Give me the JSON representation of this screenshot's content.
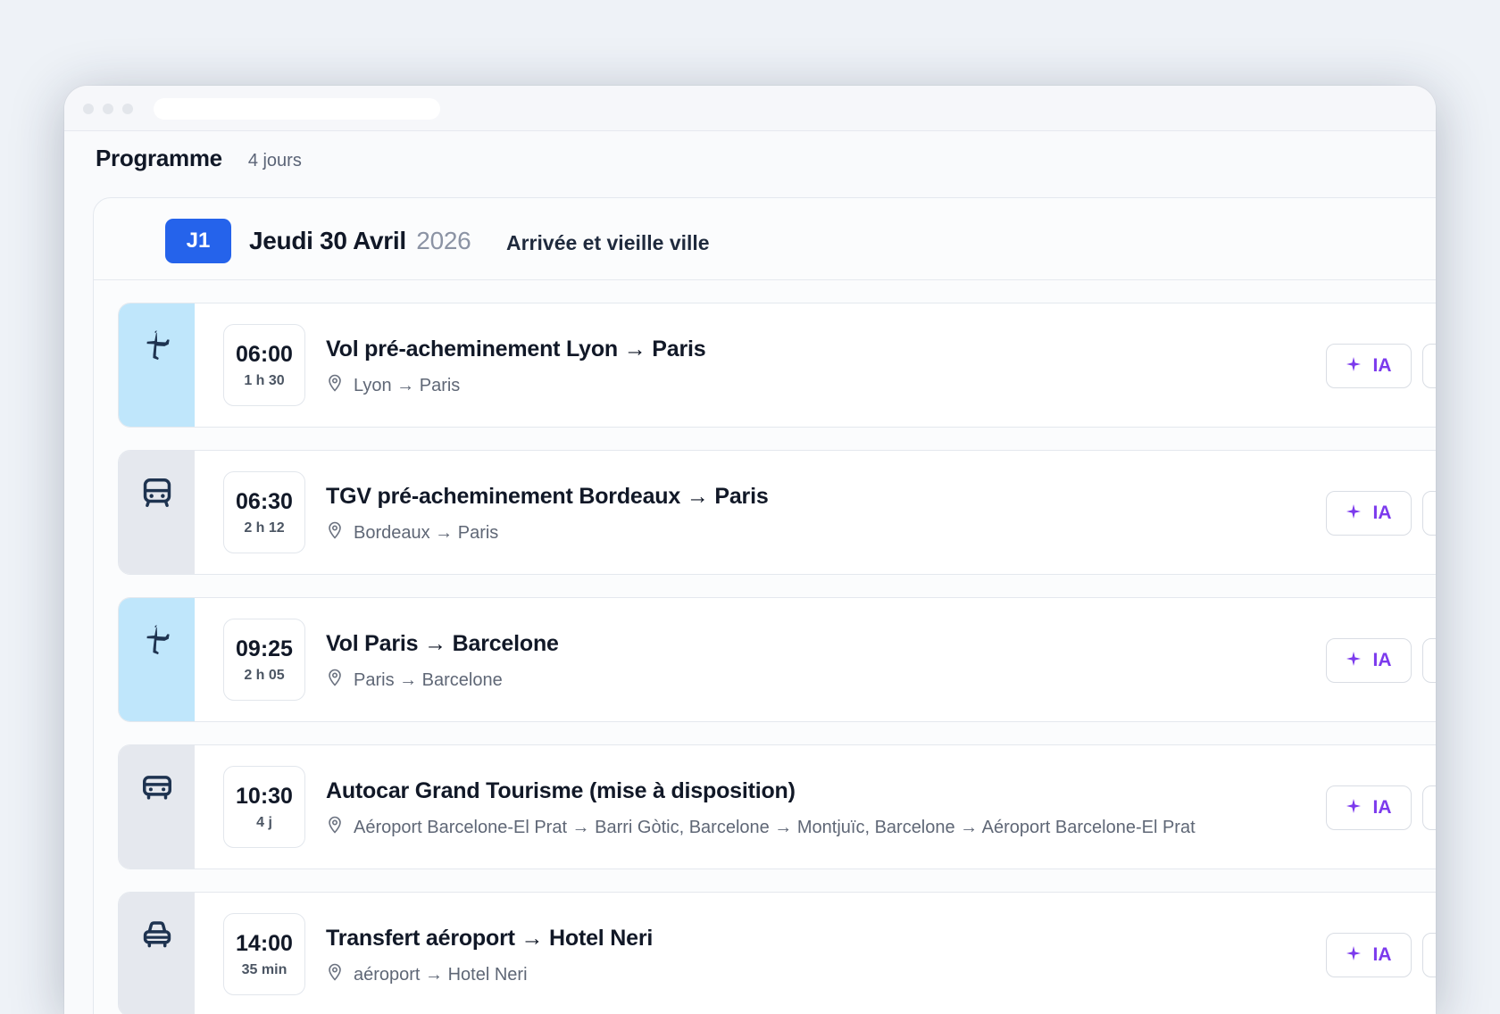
{
  "program": {
    "title": "Programme",
    "days_count": "4 jours"
  },
  "day": {
    "badge": "J1",
    "date": "Jeudi 30 Avril",
    "year": "2026",
    "subtitle": "Arrivée et vieille ville"
  },
  "events": [
    {
      "type": "flight",
      "icon": "plane-icon",
      "time": "06:00",
      "duration": "1 h 30",
      "title": "Vol pré-acheminement Lyon → Paris",
      "location": "Lyon → Paris",
      "ia_label": "IA"
    },
    {
      "type": "train",
      "icon": "train-icon",
      "time": "06:30",
      "duration": "2 h 12",
      "title": "TGV pré-acheminement Bordeaux → Paris",
      "location": "Bordeaux → Paris",
      "ia_label": "IA"
    },
    {
      "type": "flight",
      "icon": "plane-icon",
      "time": "09:25",
      "duration": "2 h 05",
      "title": "Vol Paris → Barcelone",
      "location": "Paris → Barcelone",
      "ia_label": "IA"
    },
    {
      "type": "coach",
      "icon": "bus-icon",
      "time": "10:30",
      "duration": "4 j",
      "title": "Autocar Grand Tourisme (mise à disposition)",
      "location": "Aéroport Barcelone-El Prat → Barri Gòtic, Barcelone → Montjuïc, Barcelone → Aéroport Barcelone-El Prat",
      "ia_label": "IA"
    },
    {
      "type": "transfer",
      "icon": "car-icon",
      "time": "14:00",
      "duration": "35 min",
      "title": "Transfert aéroport → Hotel Neri",
      "location": "aéroport → Hotel Neri",
      "ia_label": "IA"
    }
  ],
  "colors": {
    "accent": "#2563eb",
    "ia": "#7c3aed",
    "flight_side": "#bfe6fb",
    "ground_side": "#e5e8ee",
    "icon": "#1e3350"
  }
}
